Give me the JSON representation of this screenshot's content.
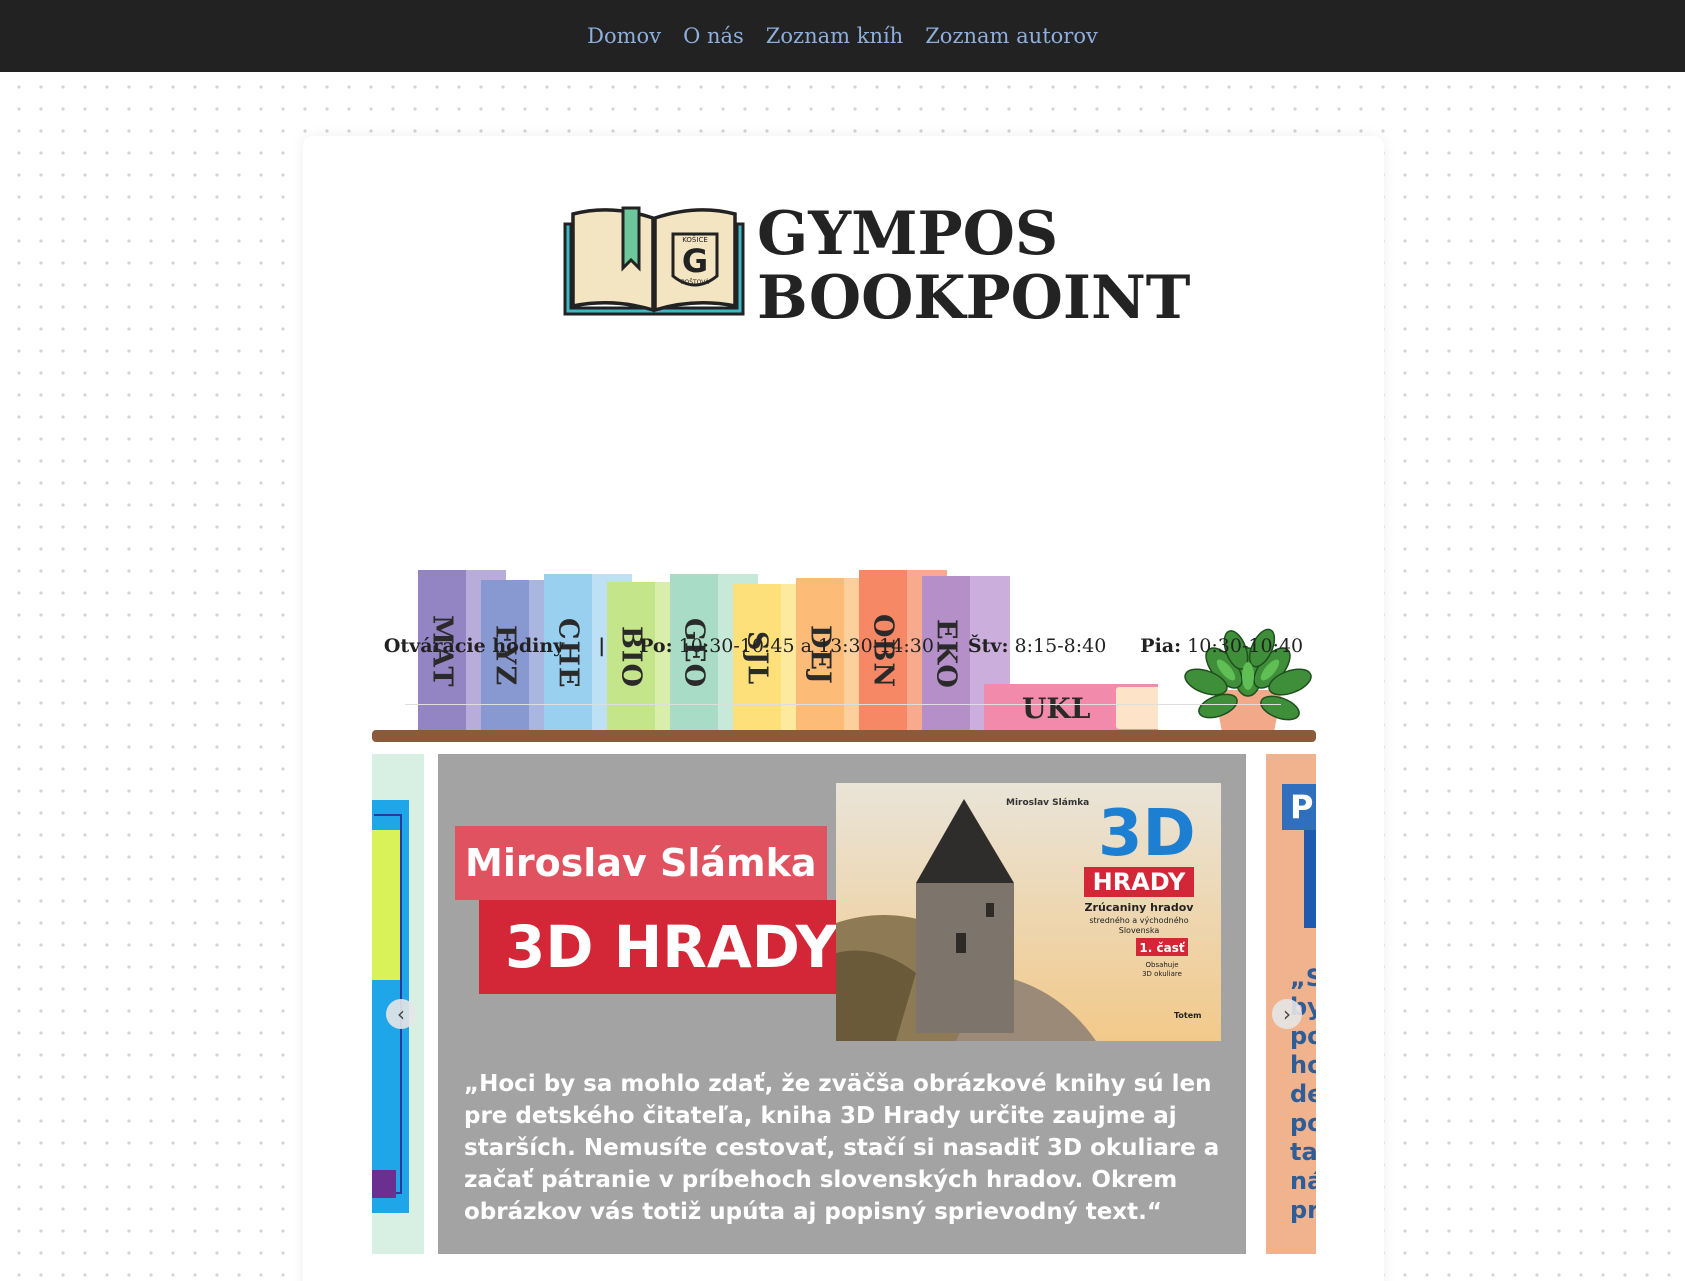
{
  "nav": {
    "items": [
      {
        "label": "Domov"
      },
      {
        "label": "O nás"
      },
      {
        "label": "Zoznam kníh"
      },
      {
        "label": "Zoznam autorov"
      }
    ],
    "link_color": "#8eaedb",
    "bg_color": "#222222"
  },
  "logo": {
    "line1": "GYMPOS",
    "line2": "BOOKPOINT",
    "emblem_letter": "G",
    "emblem_top_text": "KOŠICE",
    "emblem_bottom_text": "POŠTOVÁ"
  },
  "shelf": {
    "books": [
      {
        "label": "MAT",
        "color": "#9385c4",
        "edge": "#b8acdb"
      },
      {
        "label": "FYZ",
        "color": "#8898d0",
        "edge": "#aab6e0"
      },
      {
        "label": "CHE",
        "color": "#99d0f0",
        "edge": "#bde0f5"
      },
      {
        "label": "BIO",
        "color": "#c5e58a",
        "edge": "#d9eeab"
      },
      {
        "label": "GEO",
        "color": "#a9dcc7",
        "edge": "#c7e9da"
      },
      {
        "label": "SJL",
        "color": "#fde07a",
        "edge": "#feea9e"
      },
      {
        "label": "DEJ",
        "color": "#fdbb78",
        "edge": "#fdcf9d"
      },
      {
        "label": "OBN",
        "color": "#f68866",
        "edge": "#f8aa8f"
      },
      {
        "label": "EKO",
        "color": "#b58fc8",
        "edge": "#cbaedb"
      }
    ],
    "lying_book": {
      "label": "UKL",
      "color": "#f28aab"
    },
    "board_color": "#8a5a3b"
  },
  "hours": {
    "title": "Otváracie hodiny",
    "separator": "|",
    "days": [
      {
        "day": "Po:",
        "time": "10:30-10:45 a 13:30-14:30"
      },
      {
        "day": "Štv:",
        "time": "8:15-8:40"
      },
      {
        "day": "Pia:",
        "time": "10:30-10:40"
      }
    ]
  },
  "carousel": {
    "current_slide": {
      "author": "Miroslav Slámka",
      "title": "3D HRADY",
      "quote": "„Hoci by sa mohlo zdať, že zväčša obrázkové knihy sú len pre detského čitateľa, kniha 3D Hrady určite zaujme aj starších. Nemusíte cestovať, stačí si nasadiť 3D okuliare a začať pátranie v príbehoch slovenských hradov. Okrem obrázkov vás totiž upúta aj popisný sprievodný text.“",
      "cover": {
        "author": "Miroslav Slámka",
        "big_title": "3D",
        "subtitle": "HRADY",
        "desc": "Zrúcaniny hradov",
        "desc2": "stredného a východného",
        "desc3": "Slovenska",
        "part": "1. časť",
        "note": "Obsahuje",
        "note2": "3D okuliare",
        "publisher": "Totem"
      }
    },
    "next_slide_letter": "P",
    "next_slide_text": "„S\nby\npo\nho\nde\npo\ntaj\nná\npr",
    "prev_label": "‹",
    "next_label": "›"
  }
}
